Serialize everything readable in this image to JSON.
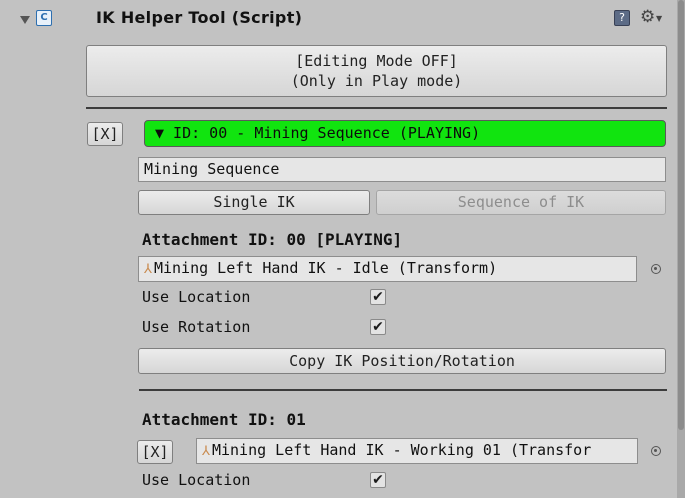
{
  "component": {
    "title": "IK Helper Tool (Script)",
    "editing_mode_line1": "[Editing Mode OFF]",
    "editing_mode_line2": "(Only in Play mode)"
  },
  "sequence": {
    "remove_label": "[X]",
    "header": "▼ ID: 00 - Mining Sequence (PLAYING)",
    "header_color": "#11e40f",
    "name_value": "Mining Sequence",
    "single_ik_label": "Single IK",
    "sequence_ik_label": "Sequence of IK"
  },
  "attachments": [
    {
      "heading": "Attachment ID: 00 [PLAYING]",
      "target": "Mining Left Hand IK - Idle (Transform)",
      "use_location_label": "Use Location",
      "use_location": true,
      "use_rotation_label": "Use Rotation",
      "use_rotation": true,
      "copy_label": "Copy IK Position/Rotation"
    },
    {
      "heading": "Attachment ID: 01",
      "remove_label": "[X]",
      "target": "Mining Left Hand IK - Working 01 (Transfor",
      "use_location_label": "Use Location",
      "use_location": true
    }
  ],
  "icons": {
    "fold": "triangle-down-icon",
    "script": "script-icon",
    "help": "help-icon",
    "gear": "gear-icon",
    "transform": "transform-icon",
    "object_picker": "object-picker-icon",
    "checkbox": "check-icon"
  }
}
